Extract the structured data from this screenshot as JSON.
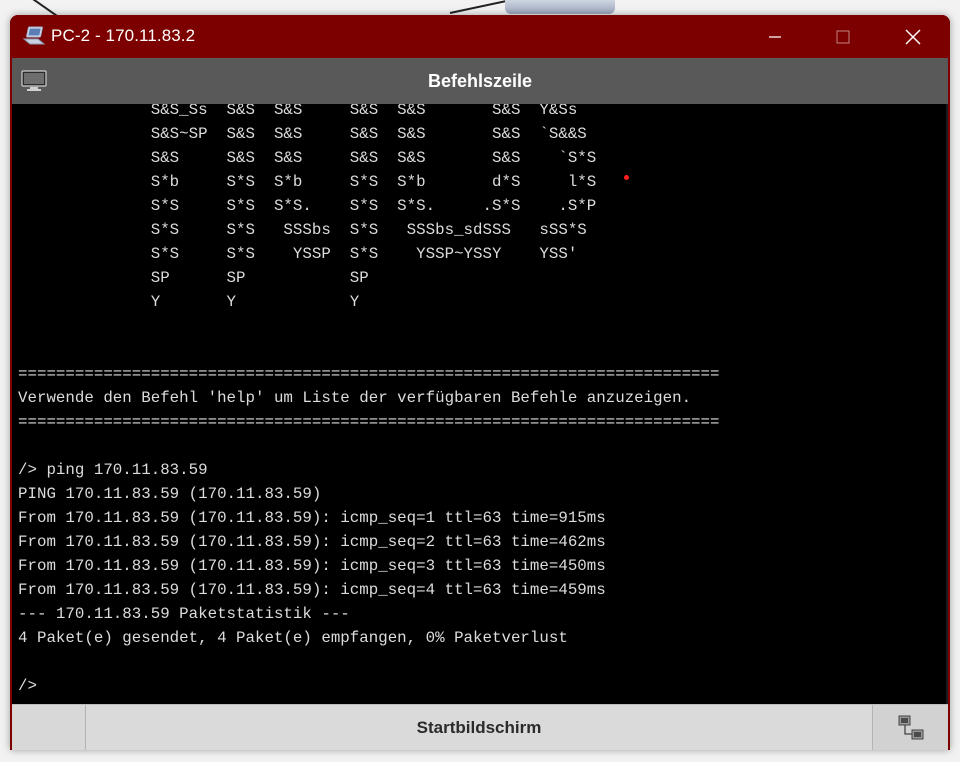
{
  "window": {
    "title": "PC-2 - 170.11.83.2",
    "minimize_glyph": "—",
    "close_glyph": "✕"
  },
  "header": {
    "title": "Befehlszeile"
  },
  "terminal": {
    "lines": [
      "              S&S_Ss  S&S  S&S     S&S  S&S       S&S  Y&Ss",
      "              S&S~SP  S&S  S&S     S&S  S&S       S&S  `S&&S",
      "              S&S     S&S  S&S     S&S  S&S       S&S    `S*S",
      "              S*b     S*S  S*b     S*S  S*b       d*S     l*S",
      "              S*S     S*S  S*S.    S*S  S*S.     .S*S    .S*P",
      "              S*S     S*S   SSSbs  S*S   SSSbs_sdSSS   sSS*S",
      "              S*S     S*S    YSSP  S*S    YSSP~YSSY    YSS'",
      "              SP      SP           SP",
      "              Y       Y            Y",
      "",
      "",
      "==========================================================================",
      "Verwende den Befehl 'help' um Liste der verfügbaren Befehle anzuzeigen.",
      "==========================================================================",
      "",
      "/> ping 170.11.83.59",
      "PING 170.11.83.59 (170.11.83.59)",
      "From 170.11.83.59 (170.11.83.59): icmp_seq=1 ttl=63 time=915ms",
      "From 170.11.83.59 (170.11.83.59): icmp_seq=2 ttl=63 time=462ms",
      "From 170.11.83.59 (170.11.83.59): icmp_seq=3 ttl=63 time=450ms",
      "From 170.11.83.59 (170.11.83.59): icmp_seq=4 ttl=63 time=459ms",
      "--- 170.11.83.59 Paketstatistik ---",
      "4 Paket(e) gesendet, 4 Paket(e) empfangen, 0% Paketverlust",
      "",
      "/>"
    ]
  },
  "footer": {
    "home_label": "Startbildschirm"
  },
  "icons": {
    "app": "laptop-icon",
    "header": "monitor-icon",
    "network": "network-icon"
  },
  "colors": {
    "titlebar": "#7c0000",
    "header": "#595959",
    "terminal_bg": "#000000",
    "terminal_fg": "#dcdcdc"
  }
}
